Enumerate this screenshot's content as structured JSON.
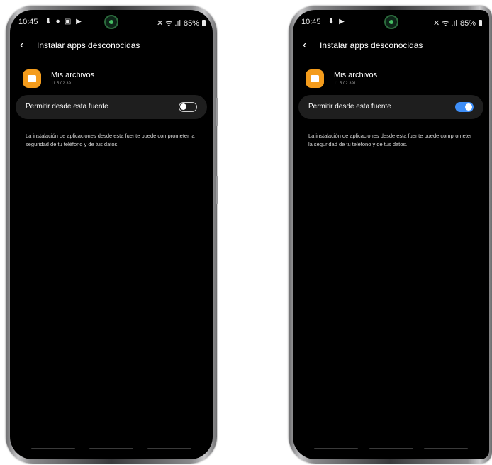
{
  "screens": [
    {
      "status": {
        "time": "10:45",
        "icons_left": "⬇ ⏺ ▣ ▶",
        "icons_right": "✕ ᯤ .ıl",
        "battery": "85%"
      },
      "appbar": {
        "back_icon": "chevron-left-icon",
        "title": "Instalar apps desconocidas"
      },
      "app": {
        "name": "Mis archivos",
        "version": "11.5.02.391",
        "icon_color": "#f49c1c"
      },
      "setting": {
        "label": "Permitir desde esta fuente",
        "enabled": false
      },
      "warning": "La instalación de aplicaciones desde esta fuente puede comprometer la seguridad de tu teléfono y de tus datos."
    },
    {
      "status": {
        "time": "10:45",
        "icons_left": "⬇ ▶",
        "icons_right": "✕ ᯤ .ıl",
        "battery": "85%"
      },
      "appbar": {
        "back_icon": "chevron-left-icon",
        "title": "Instalar apps desconocidas"
      },
      "app": {
        "name": "Mis archivos",
        "version": "11.5.02.391",
        "icon_color": "#f49c1c"
      },
      "setting": {
        "label": "Permitir desde esta fuente",
        "enabled": true,
        "accent": "#3e8ef7"
      },
      "warning": "La instalación de aplicaciones desde esta fuente puede comprometer la seguridad de tu teléfono y de tus datos."
    }
  ]
}
